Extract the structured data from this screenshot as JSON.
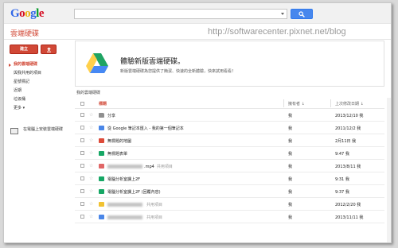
{
  "topbar": {
    "logo_letters": [
      {
        "ch": "G",
        "color": "#3369e8"
      },
      {
        "ch": "o",
        "color": "#d50f25"
      },
      {
        "ch": "o",
        "color": "#eeb211"
      },
      {
        "ch": "g",
        "color": "#3369e8"
      },
      {
        "ch": "l",
        "color": "#009925"
      },
      {
        "ch": "e",
        "color": "#d50f25"
      }
    ],
    "search_value": "",
    "search_button_icon": "search-icon"
  },
  "subbar": {
    "app_title": "雲端硬碟",
    "watermark": "http://softwarecenter.pixnet.net/blog"
  },
  "sidebar": {
    "create_label": "建立",
    "upload_icon": "upload-icon",
    "items": [
      {
        "label": "我的雲端硬碟",
        "active": true
      },
      {
        "label": "與我共用的項目",
        "active": false
      },
      {
        "label": "星號標記",
        "active": false
      },
      {
        "label": "近期",
        "active": false
      },
      {
        "label": "垃圾桶",
        "active": false
      }
    ],
    "more_label": "更多 ▾",
    "desktop_label": "在電腦上安裝雲端硬碟"
  },
  "banner": {
    "title": "體驗新版雲端硬碟。",
    "text": "新版雲端硬碟為您提供了簡潔、快速的全新體驗，快來試用看看！"
  },
  "breadcrumb": "我的雲端硬碟",
  "list": {
    "columns": {
      "title": "標題",
      "owner": "擁有者 ↓",
      "modified": "上次修改日期 ↓"
    },
    "rows": [
      {
        "icon": "folder-icon",
        "icon_color": "#8f8f8f",
        "blurred": false,
        "name": "分享",
        "suffix": "",
        "owner": "我",
        "modified": "2013/12/10 我"
      },
      {
        "icon": "document-icon",
        "icon_color": "#4a86e8",
        "blurred": false,
        "name": "從 Google 筆記本匯入 - 我的第一個筆記本",
        "suffix": "",
        "owner": "我",
        "modified": "2011/12/2 我"
      },
      {
        "icon": "map-icon",
        "icon_color": "#dd4b39",
        "blurred": false,
        "name": "無標題的地圖",
        "suffix": "",
        "owner": "我",
        "modified": "2月11日 我"
      },
      {
        "icon": "spreadsheet-icon",
        "icon_color": "#16a765",
        "blurred": false,
        "name": "無標題表單",
        "suffix": "",
        "owner": "我",
        "modified": "9:47 我"
      },
      {
        "icon": "video-icon",
        "icon_color": "#e06666",
        "blurred": true,
        "name": ".mp4",
        "suffix": "共用項目",
        "owner": "我",
        "modified": "2013/8/11 我"
      },
      {
        "icon": "spreadsheet-icon",
        "icon_color": "#16a765",
        "blurred": false,
        "name": "電腦分析室課上2F",
        "suffix": "",
        "owner": "我",
        "modified": "9:31 我"
      },
      {
        "icon": "spreadsheet-icon",
        "icon_color": "#16a765",
        "blurred": false,
        "name": "電腦分析室課上2F (回覆內容)",
        "suffix": "",
        "owner": "我",
        "modified": "9:37 我"
      },
      {
        "icon": "presentation-icon",
        "icon_color": "#f1c232",
        "blurred": true,
        "name": "",
        "suffix": "共用項目",
        "owner": "我",
        "modified": "2012/2/20 我"
      },
      {
        "icon": "file-icon",
        "icon_color": "#4a86e8",
        "blurred": true,
        "name": "",
        "suffix": "共用項目",
        "owner": "我",
        "modified": "2013/11/11 我"
      }
    ]
  }
}
